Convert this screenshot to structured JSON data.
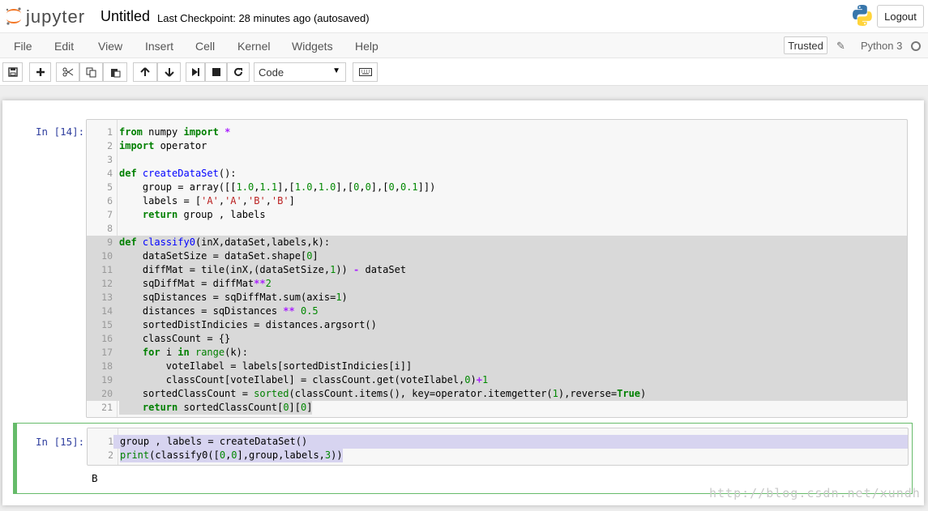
{
  "header": {
    "logo_text": "jupyter",
    "notebook_name": "Untitled",
    "checkpoint": "Last Checkpoint: 28 minutes ago (autosaved)",
    "logout_label": "Logout"
  },
  "menubar": {
    "items": [
      "File",
      "Edit",
      "View",
      "Insert",
      "Cell",
      "Kernel",
      "Widgets",
      "Help"
    ],
    "trusted_label": "Trusted",
    "kernel_name": "Python 3"
  },
  "toolbar": {
    "cell_type": "Code",
    "buttons": [
      "save-icon",
      "plus-icon",
      "cut-icon",
      "copy-icon",
      "paste-icon",
      "arrow-up-icon",
      "arrow-down-icon",
      "step-forward-icon",
      "stop-icon",
      "refresh-icon",
      "keyboard-icon"
    ]
  },
  "cells": [
    {
      "prompt": "In [14]:",
      "line_numbers": [
        "1",
        "2",
        "3",
        "4",
        "5",
        "6",
        "7",
        "8",
        "9",
        "10",
        "11",
        "12",
        "13",
        "14",
        "15",
        "16",
        "17",
        "18",
        "19",
        "20",
        "21"
      ]
    },
    {
      "prompt": "In [15]:",
      "line_numbers": [
        "1",
        "2"
      ],
      "output": "B"
    }
  ],
  "watermark": "http://blog.csdn.net/xundh",
  "colors": {
    "prompt_in": "#303f9f",
    "keyword": "#008000",
    "operator": "#aa22ff",
    "function_def": "#0000ff",
    "string": "#ba2121",
    "selected_cell_border": "#66bb6a"
  }
}
